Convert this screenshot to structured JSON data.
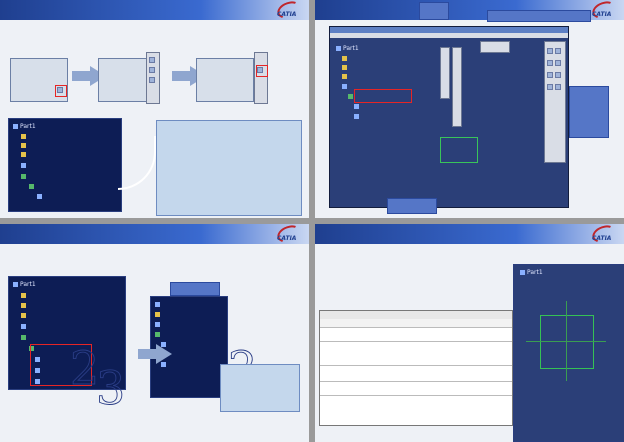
{
  "slides": [
    {
      "title": "",
      "logo_text": "CATIA",
      "intro": ""
    },
    {
      "title": "",
      "logo_text": "CATIA"
    },
    {
      "title": "",
      "logo_text": "CATIA"
    },
    {
      "title": "",
      "logo_text": "CATIA"
    }
  ],
  "tree": {
    "root": "Part1"
  }
}
